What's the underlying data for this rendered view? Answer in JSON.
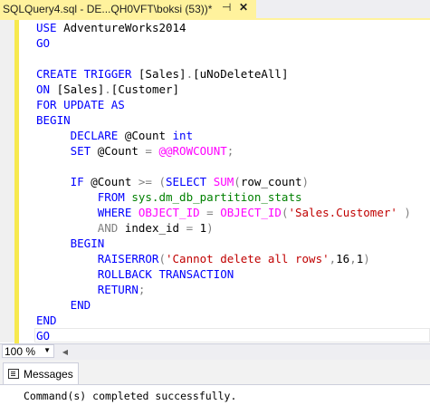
{
  "tab": {
    "title": "SQLQuery4.sql - DE...QH0VFT\\boksi (53))*",
    "pin_glyph": "⊣",
    "close_glyph": "✕"
  },
  "editor": {
    "lines": [
      [
        {
          "t": "USE ",
          "c": "kw"
        },
        {
          "t": "AdventureWorks2014",
          "c": ""
        }
      ],
      [
        {
          "t": "GO",
          "c": "kw"
        }
      ],
      [],
      [
        {
          "t": "CREATE TRIGGER ",
          "c": "kw"
        },
        {
          "t": "[Sales]",
          "c": ""
        },
        {
          "t": ".",
          "c": "gr"
        },
        {
          "t": "[uNoDeleteAll]",
          "c": ""
        }
      ],
      [
        {
          "t": "ON ",
          "c": "kw"
        },
        {
          "t": "[Sales]",
          "c": ""
        },
        {
          "t": ".",
          "c": "gr"
        },
        {
          "t": "[Customer]",
          "c": ""
        }
      ],
      [
        {
          "t": "FOR UPDATE AS",
          "c": "kw"
        }
      ],
      [
        {
          "t": "BEGIN",
          "c": "kw"
        }
      ],
      [
        {
          "t": "     DECLARE ",
          "c": "kw"
        },
        {
          "t": "@Count ",
          "c": ""
        },
        {
          "t": "int",
          "c": "kw"
        }
      ],
      [
        {
          "t": "     SET ",
          "c": "kw"
        },
        {
          "t": "@Count ",
          "c": ""
        },
        {
          "t": "= ",
          "c": "gr"
        },
        {
          "t": "@@ROWCOUNT",
          "c": "fn"
        },
        {
          "t": ";",
          "c": "gr"
        }
      ],
      [],
      [
        {
          "t": "     IF ",
          "c": "kw"
        },
        {
          "t": "@Count ",
          "c": ""
        },
        {
          "t": ">= (",
          "c": "gr"
        },
        {
          "t": "SELECT ",
          "c": "kw"
        },
        {
          "t": "SUM",
          "c": "fn"
        },
        {
          "t": "(",
          "c": "gr"
        },
        {
          "t": "row_count",
          "c": ""
        },
        {
          "t": ")",
          "c": "gr"
        }
      ],
      [
        {
          "t": "         FROM ",
          "c": "kw"
        },
        {
          "t": "sys.dm_db_partition_stats",
          "c": "sys"
        }
      ],
      [
        {
          "t": "         WHERE ",
          "c": "kw"
        },
        {
          "t": "OBJECT_ID ",
          "c": "fn"
        },
        {
          "t": "= ",
          "c": "gr"
        },
        {
          "t": "OBJECT_ID",
          "c": "fn"
        },
        {
          "t": "(",
          "c": "gr"
        },
        {
          "t": "'Sales.Customer'",
          "c": "str"
        },
        {
          "t": " )",
          "c": "gr"
        }
      ],
      [
        {
          "t": "         AND ",
          "c": "gr"
        },
        {
          "t": "index_id ",
          "c": ""
        },
        {
          "t": "= ",
          "c": "gr"
        },
        {
          "t": "1",
          "c": ""
        },
        {
          "t": ")",
          "c": "gr"
        }
      ],
      [
        {
          "t": "     BEGIN",
          "c": "kw"
        }
      ],
      [
        {
          "t": "         RAISERROR",
          "c": "kw"
        },
        {
          "t": "(",
          "c": "gr"
        },
        {
          "t": "'Cannot delete all rows'",
          "c": "str"
        },
        {
          "t": ",",
          "c": "gr"
        },
        {
          "t": "16",
          "c": ""
        },
        {
          "t": ",",
          "c": "gr"
        },
        {
          "t": "1",
          "c": ""
        },
        {
          "t": ")",
          "c": "gr"
        }
      ],
      [
        {
          "t": "         ROLLBACK TRANSACTION",
          "c": "kw"
        }
      ],
      [
        {
          "t": "         RETURN",
          "c": "kw"
        },
        {
          "t": ";",
          "c": "gr"
        }
      ],
      [
        {
          "t": "     END",
          "c": "kw"
        }
      ],
      [
        {
          "t": "END",
          "c": "kw"
        }
      ],
      [
        {
          "t": "GO",
          "c": "kw"
        }
      ]
    ],
    "colors": {
      "keyword": "#0000ff",
      "string": "#c00000",
      "function": "#ff00ff",
      "system_object": "#008000",
      "operator": "#808080",
      "change_bar": "#f7e94f",
      "tab_active": "#fff29d"
    }
  },
  "status": {
    "zoom": "100 %",
    "zoom_arrow": "▼",
    "scroll_left_arrow": "◀"
  },
  "results": {
    "tab_label": "Messages",
    "tab_icon": "messages-icon",
    "message": "Command(s) completed successfully."
  }
}
